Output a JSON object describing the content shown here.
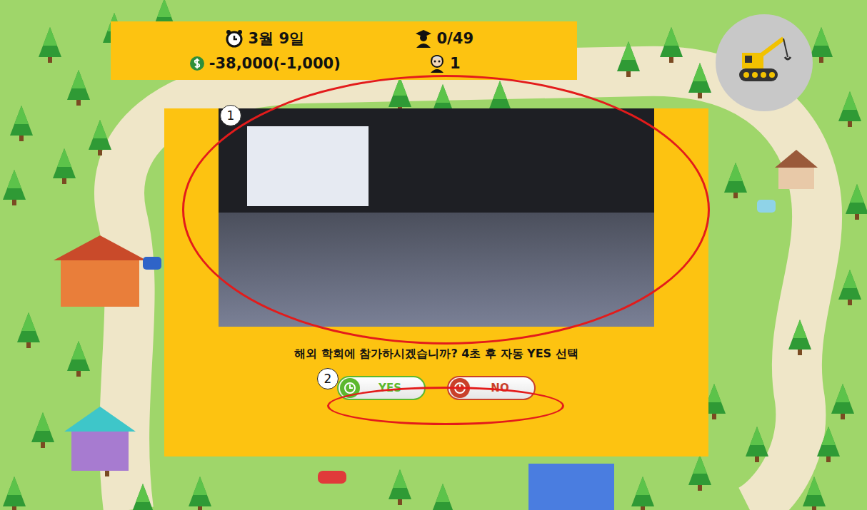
{
  "hud": {
    "date": "3월 9일",
    "students": "0/49",
    "money": "-38,000(-1,000)",
    "professors": "1"
  },
  "dialog": {
    "question": "해외 학회에 참가하시겠습니까? 4초 후 자동 YES 선택",
    "buttons": [
      {
        "label": "YES",
        "color": "#5cb82e"
      },
      {
        "label": "NO",
        "color": "#c9412b"
      }
    ]
  },
  "annotations": [
    {
      "label": "1"
    },
    {
      "label": "2"
    }
  ]
}
